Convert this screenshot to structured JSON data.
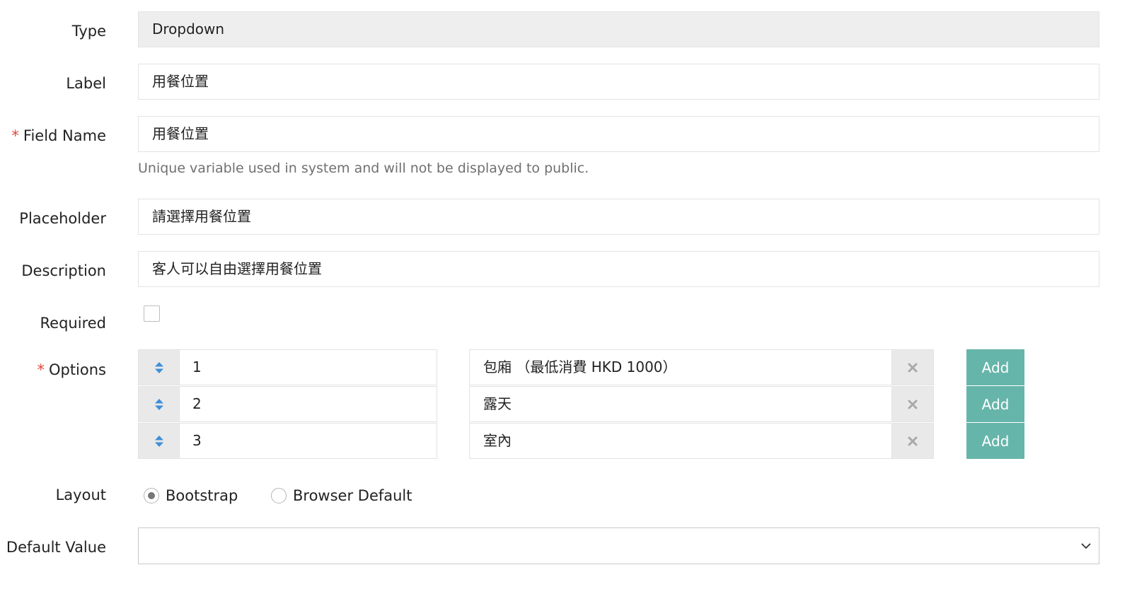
{
  "fields": {
    "type": {
      "label": "Type",
      "value": "Dropdown"
    },
    "label": {
      "label": "Label",
      "value": "用餐位置"
    },
    "field_name": {
      "required_mark": "*",
      "label": "Field Name",
      "value": "用餐位置",
      "hint": "Unique variable used in system and will not be displayed to public."
    },
    "placeholder": {
      "label": "Placeholder",
      "value": "請選擇用餐位置"
    },
    "description": {
      "label": "Description",
      "value": "客人可以自由選擇用餐位置"
    },
    "required": {
      "label": "Required",
      "checked": false
    },
    "options": {
      "required_mark": "*",
      "label": "Options",
      "add_label": "Add",
      "items": [
        {
          "value": "1",
          "text": "包廂 （最低消費 HKD 1000）"
        },
        {
          "value": "2",
          "text": "露天"
        },
        {
          "value": "3",
          "text": "室內"
        }
      ]
    },
    "layout": {
      "label": "Layout",
      "options": [
        {
          "label": "Bootstrap",
          "selected": true
        },
        {
          "label": "Browser Default",
          "selected": false
        }
      ]
    },
    "default_value": {
      "label": "Default Value",
      "value": ""
    }
  },
  "colors": {
    "accent_add": "#66b5aa",
    "sort_icon": "#3f8fd9",
    "required_mark": "#e0453b"
  },
  "icons": {
    "sort": "sort-arrows-icon",
    "remove": "close-icon",
    "select": "chevron-down-icon"
  }
}
